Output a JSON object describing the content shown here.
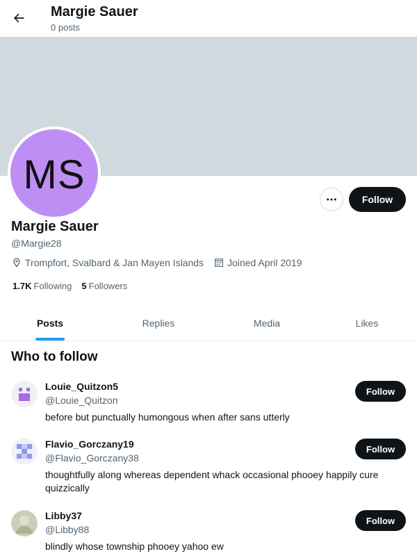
{
  "header": {
    "title": "Margie Sauer",
    "subtitle": "0 posts",
    "back_icon": "arrow-left-icon"
  },
  "profile": {
    "initials": "MS",
    "avatar_color": "#bf8ef5",
    "banner_color": "#cfd9de",
    "display_name": "Margie Sauer",
    "handle": "@Margie28",
    "location": "Trompfort, Svalbard & Jan Mayen Islands",
    "joined": "Joined April 2019",
    "following_count": "1.7K",
    "following_label": "Following",
    "followers_count": "5",
    "followers_label": "Followers",
    "follow_label": "Follow"
  },
  "tabs": [
    {
      "label": "Posts",
      "active": true
    },
    {
      "label": "Replies",
      "active": false
    },
    {
      "label": "Media",
      "active": false
    },
    {
      "label": "Likes",
      "active": false
    }
  ],
  "who_to_follow": {
    "title": "Who to follow",
    "items": [
      {
        "name": "Louie_Quitzon5",
        "handle": "@Louie_Quitzon",
        "bio": "before but punctually humongous when after sans utterly",
        "follow_label": "Follow"
      },
      {
        "name": "Flavio_Gorczany19",
        "handle": "@Flavio_Gorczany38",
        "bio": "thoughtfully along whereas dependent whack occasional phooey happily cure quizzically",
        "follow_label": "Follow"
      },
      {
        "name": "Libby37",
        "handle": "@Libby88",
        "bio": "blindly whose township phooey yahoo ew",
        "follow_label": "Follow"
      }
    ]
  },
  "colors": {
    "accent": "#1d9bf0",
    "button_bg": "#0f1419",
    "muted_text": "#536471"
  }
}
